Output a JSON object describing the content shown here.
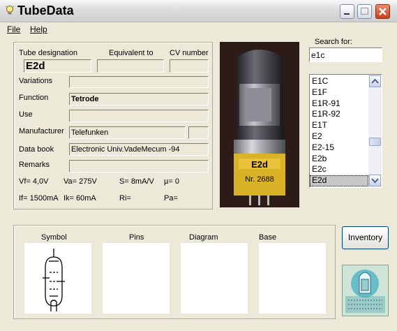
{
  "window": {
    "title": "TubeData",
    "icon": "lightbulb-icon"
  },
  "menu": {
    "file": "File",
    "help": "Help"
  },
  "details": {
    "tube_designation_label": "Tube designation",
    "tube_designation": "E2d",
    "equivalent_label": "Equivalent to",
    "equivalent": "",
    "cv_label": "CV number",
    "cv": "",
    "variations_label": "Variations",
    "variations": "",
    "function_label": "Function",
    "function": "Tetrode",
    "use_label": "Use",
    "use": "",
    "manufacturer_label": "Manufacturer",
    "manufacturer": "Telefunken",
    "manufacturer_extra": "",
    "databook_label": "Data book",
    "databook": "Electronic Univ.VadeMecum -94",
    "remarks_label": "Remarks",
    "remarks": "",
    "vf": "Vf= 4,0V",
    "va": "Va= 275V",
    "s": "S= 8mA/V",
    "mu": "µ= 0",
    "if": "If= 1500mA",
    "ik": "Ik= 60mA",
    "ri": "Ri=",
    "pa": "Pa="
  },
  "photo": {
    "label_top": "E2d",
    "label_bottom": "Nr. 2688"
  },
  "search": {
    "label": "Search for:",
    "value": "e1c",
    "items": [
      "E1C",
      "E1F",
      "E1R-91",
      "E1R-92",
      "E1T",
      "E2",
      "E2-15",
      "E2b",
      "E2c",
      "E2d"
    ],
    "selected": "E2d"
  },
  "panels": {
    "symbol": "Symbol",
    "pins": "Pins",
    "diagram": "Diagram",
    "base": "Base"
  },
  "inventory_button": "Inventory"
}
